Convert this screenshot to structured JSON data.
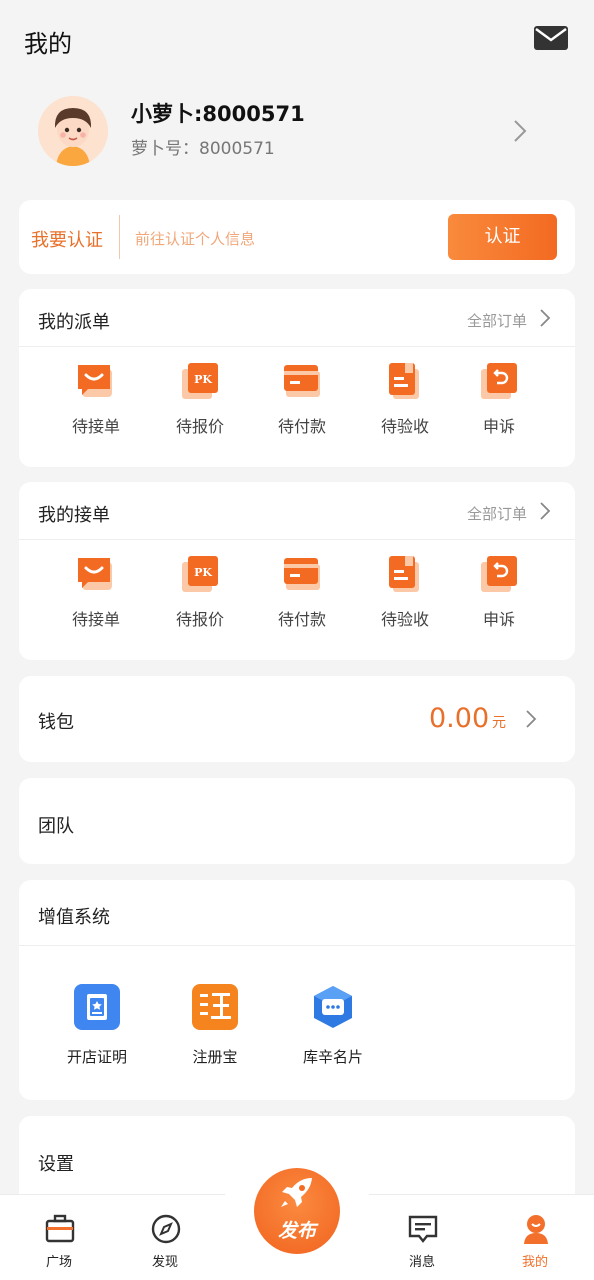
{
  "header": {
    "title": "我的",
    "mail_icon": "mail-icon"
  },
  "profile": {
    "nickname": "小萝卜:8000571",
    "account": "萝卜号：8000571"
  },
  "verify": {
    "title": "我要认证",
    "hint": "前往认证个人信息",
    "button": "认证"
  },
  "dispatch_orders": {
    "title": "我的派单",
    "all_orders": "全部订单",
    "items": [
      {
        "label": "待接单",
        "icon": "pending-accept-icon"
      },
      {
        "label": "待报价",
        "icon": "pk-quote-icon"
      },
      {
        "label": "待付款",
        "icon": "card-payment-icon"
      },
      {
        "label": "待验收",
        "icon": "document-check-icon"
      },
      {
        "label": "申诉",
        "icon": "appeal-return-icon"
      }
    ]
  },
  "accept_orders": {
    "title": "我的接单",
    "all_orders": "全部订单",
    "items": [
      {
        "label": "待接单",
        "icon": "pending-accept-icon"
      },
      {
        "label": "待报价",
        "icon": "pk-quote-icon"
      },
      {
        "label": "待付款",
        "icon": "card-payment-icon"
      },
      {
        "label": "待验收",
        "icon": "document-check-icon"
      },
      {
        "label": "申诉",
        "icon": "appeal-return-icon"
      }
    ]
  },
  "wallet": {
    "title": "钱包",
    "amount": "0.00",
    "unit": "元"
  },
  "team": {
    "title": "团队"
  },
  "value_added": {
    "title": "增值系统",
    "items": [
      {
        "label": "开店证明",
        "icon": "store-certificate-icon"
      },
      {
        "label": "注册宝",
        "icon": "register-treasure-icon"
      },
      {
        "label": "库辛名片",
        "icon": "business-card-icon"
      }
    ]
  },
  "settings": {
    "title": "设置"
  },
  "tabbar": {
    "items": [
      {
        "label": "广场",
        "icon": "briefcase-icon"
      },
      {
        "label": "发现",
        "icon": "compass-icon"
      },
      {
        "label": "消息",
        "icon": "message-icon"
      },
      {
        "label": "我的",
        "icon": "profile-icon"
      }
    ],
    "publish": {
      "label": "发布",
      "icon": "rocket-icon"
    }
  },
  "colors": {
    "accent": "#F2702B",
    "background": "#F4F4F4"
  }
}
